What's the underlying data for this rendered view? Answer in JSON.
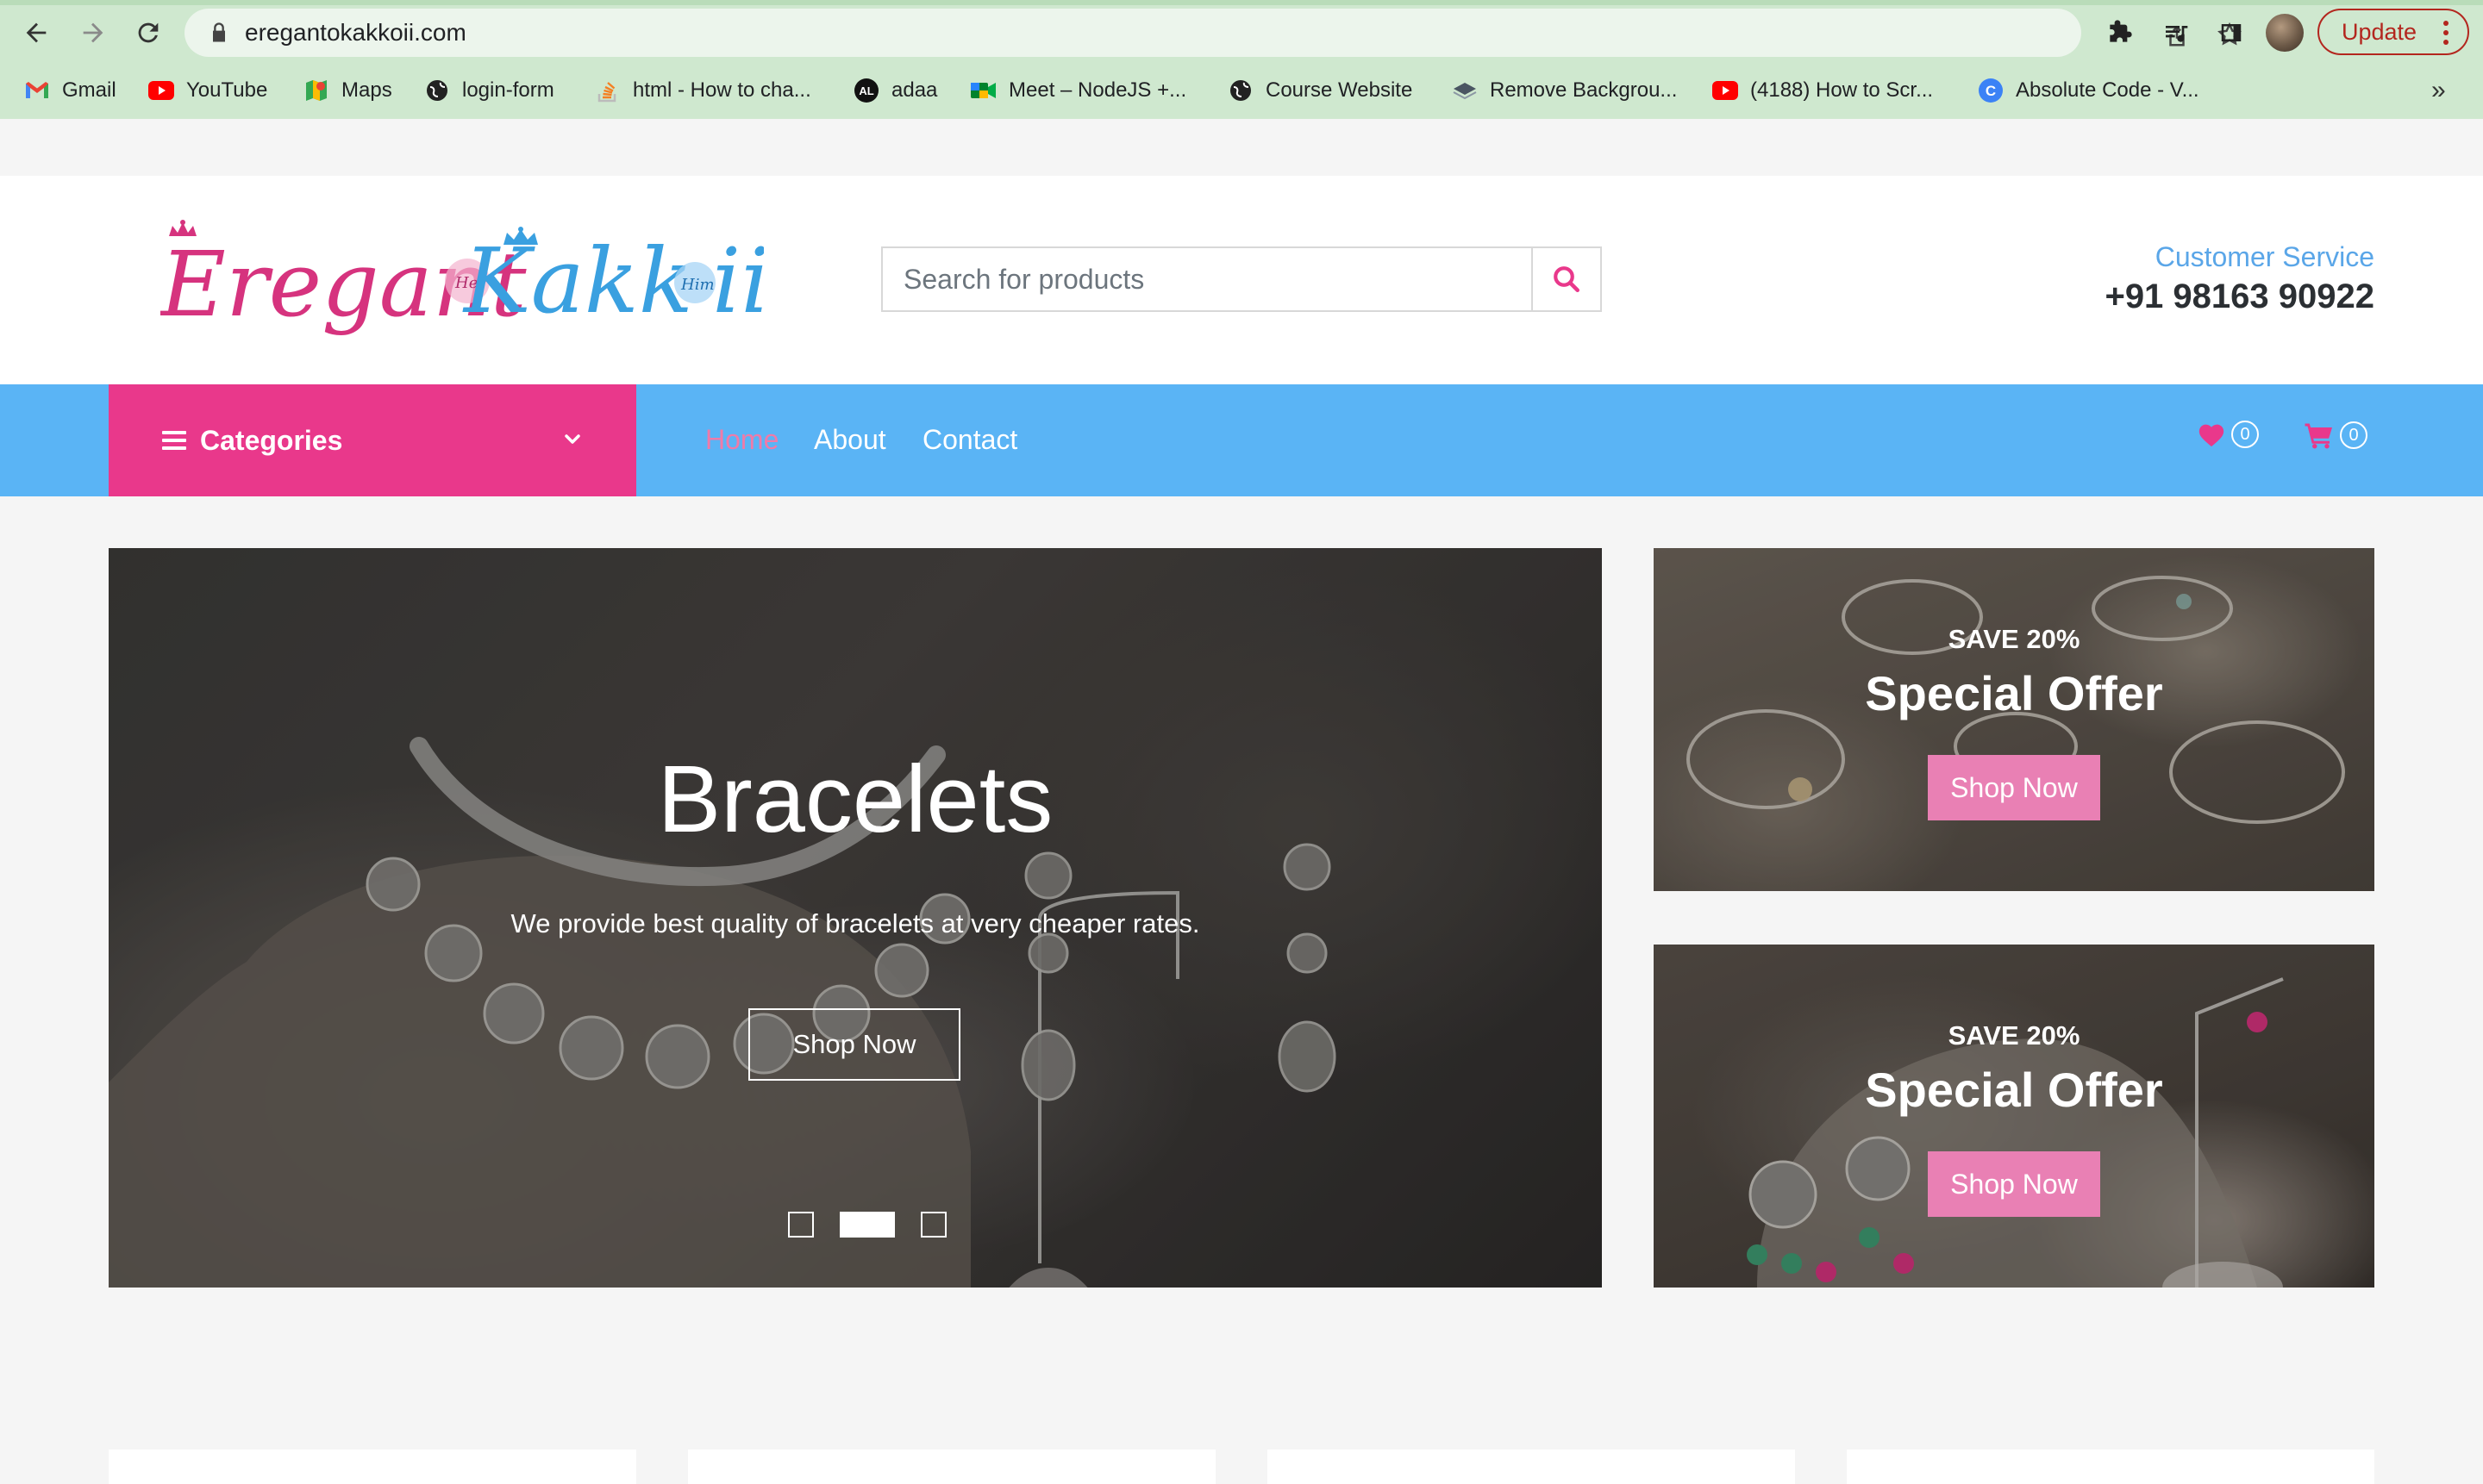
{
  "browser": {
    "url": "eregantokakkoii.com",
    "update_label": "Update",
    "bookmarks": [
      {
        "label": "Gmail",
        "icon": "gmail-icon"
      },
      {
        "label": "YouTube",
        "icon": "youtube-icon"
      },
      {
        "label": "Maps",
        "icon": "maps-icon"
      },
      {
        "label": "login-form",
        "icon": "globe-icon"
      },
      {
        "label": "html - How to cha...",
        "icon": "stackoverflow-icon"
      },
      {
        "label": "adaa",
        "icon": "adaa-icon"
      },
      {
        "label": "Meet – NodeJS +...",
        "icon": "meet-icon"
      },
      {
        "label": "Course Website",
        "icon": "globe-icon"
      },
      {
        "label": "Remove Backgrou...",
        "icon": "removebg-icon"
      },
      {
        "label": "(4188) How to Scr...",
        "icon": "youtube-icon"
      },
      {
        "label": "Absolute Code - V...",
        "icon": "absolutecode-icon"
      }
    ],
    "more_label": "»"
  },
  "header": {
    "logo_text": "ErigantoKakkoii",
    "search_placeholder": "Search for products",
    "customer_service_label": "Customer Service",
    "phone": "+91 98163 90922"
  },
  "nav": {
    "categories_label": "Categories",
    "links": [
      {
        "label": "Home",
        "active": true
      },
      {
        "label": "About",
        "active": false
      },
      {
        "label": "Contact",
        "active": false
      }
    ],
    "wishlist_count": "0",
    "cart_count": "0"
  },
  "hero": {
    "title": "Bracelets",
    "subtitle": "We provide best quality of bracelets at very cheaper rates.",
    "button_label": "Shop Now",
    "slide_count": 3,
    "active_slide": 2
  },
  "offers": [
    {
      "save": "SAVE 20%",
      "title": "Special Offer",
      "button_label": "Shop Now"
    },
    {
      "save": "SAVE 20%",
      "title": "Special Offer",
      "button_label": "Shop Now"
    }
  ],
  "colors": {
    "brand_pink": "#e9388b",
    "nav_blue": "#5ab4f5",
    "offer_button": "#e980b4",
    "accent_blue": "#5aa6e8",
    "chrome_green": "#cfe8cf"
  }
}
